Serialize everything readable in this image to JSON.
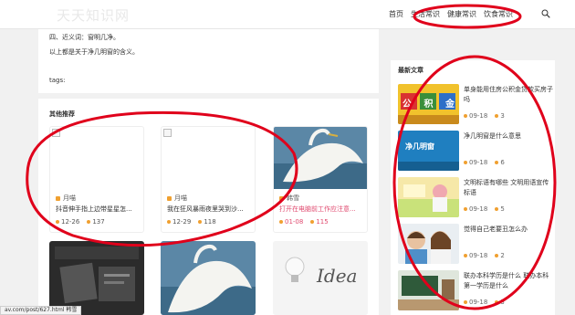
{
  "header": {
    "logo": "天天知识网",
    "nav": [
      "首页",
      "生活常识",
      "健康常识",
      "饮食常识"
    ]
  },
  "article": {
    "line1": "四、近义词：窗明几净。",
    "line2": "以上都是关于净几明窗的含义。",
    "tags": "tags:"
  },
  "related": {
    "title": "其他推荐",
    "cards": [
      {
        "author": "月喵",
        "title": "抖音伸手指上边带星星怎...",
        "date": "12-26",
        "views": "137"
      },
      {
        "author": "月喵",
        "title": "我在狂风暴雨夜里哭到沙...",
        "date": "12-29",
        "views": "118"
      },
      {
        "author": "韩雪",
        "title": "打开在电脑前工作应注意...",
        "date": "01-08",
        "views": "115"
      }
    ],
    "card4_word": "Idea"
  },
  "sidebar": {
    "title": "最新文章",
    "items": [
      {
        "title": "单身能用住房公积金贷款买房子吗",
        "date": "09-18",
        "count": "3",
        "thumb_text": "公 积 金"
      },
      {
        "title": "净几明窗是什么意思",
        "date": "09-18",
        "count": "6",
        "thumb_text": "净几明窗"
      },
      {
        "title": "文明标语有哪些 文明用语宣传标语",
        "date": "09-18",
        "count": "5"
      },
      {
        "title": "觉得自己老要丑怎么办",
        "date": "09-18",
        "count": "2"
      },
      {
        "title": "联办本科学历是什么 联办本科第一学历是什么",
        "date": "09-18",
        "count": "3"
      }
    ]
  },
  "status_url": "av.com/post/627.html 韩雪",
  "colors": {
    "annotation": "#e0001b",
    "accent_pink": "#e04a6f",
    "icon_orange": "#f0a030"
  }
}
